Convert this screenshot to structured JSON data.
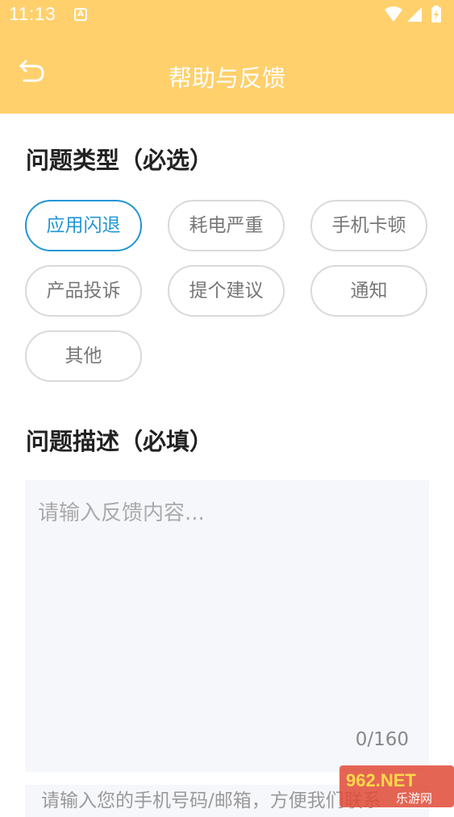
{
  "status_bar": {
    "time": "11:13",
    "app_badge": "A"
  },
  "header": {
    "title": "帮助与反馈"
  },
  "problem_type": {
    "title": "问题类型（必选）",
    "options": [
      "应用闪退",
      "耗电严重",
      "手机卡顿",
      "产品投诉",
      "提个建议",
      "通知",
      "其他"
    ],
    "selected": "应用闪退"
  },
  "description": {
    "title": "问题描述（必填）",
    "placeholder": "请输入反馈内容...",
    "counter": "0/160"
  },
  "contact": {
    "placeholder": "请输入您的手机号码/邮箱，方便我们联系"
  },
  "watermark": {
    "brand": "962.NET",
    "sub": "乐游网"
  },
  "colors": {
    "header_bg": "#FFD06C",
    "accent": "#2196D3",
    "field_bg": "#F6F7FB"
  }
}
